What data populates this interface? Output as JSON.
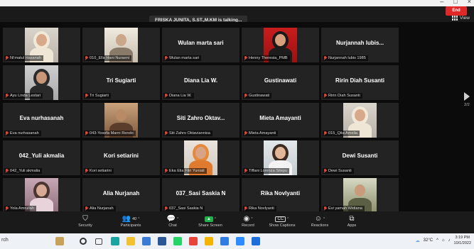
{
  "window": {
    "controls": [
      "–",
      "□",
      "×"
    ]
  },
  "header": {
    "talking": "FRISKA JUNITA, S.ST.,M.KM is talking...",
    "view_label": "View"
  },
  "page_indicator": "2/2",
  "tiles": [
    {
      "label": "Ni'matul Hasanah",
      "big": "",
      "video": "person-hijab-cream"
    },
    {
      "label": "010_Ella Hani Nuraeni",
      "big": "",
      "video": "room-light"
    },
    {
      "label": "Wulan marta sari",
      "big": "Wulan marta sari",
      "video": ""
    },
    {
      "label": "Henny Theresia_PMB",
      "big": "",
      "video": "person-red"
    },
    {
      "label": "Nurjannah lubis 1985",
      "big": "Nurjannah lubis...",
      "video": ""
    },
    {
      "label": "Ayu Linda Lestari",
      "big": "",
      "video": "person-hijab-dark"
    },
    {
      "label": "Tri Sugiarti",
      "big": "Tri Sugiarti",
      "video": ""
    },
    {
      "label": "Diana Lia W.",
      "big": "Diana Lia W.",
      "video": ""
    },
    {
      "label": "Gustinawati",
      "big": "Gustinawati",
      "video": ""
    },
    {
      "label": "Ririn Diah Susanti",
      "big": "Ririn Diah Susanti",
      "video": ""
    },
    {
      "label": "Eva nurhasanah",
      "big": "Eva nurhasanah",
      "video": ""
    },
    {
      "label": "043-Yosefa Marni Rendo",
      "big": "",
      "video": "room-warm"
    },
    {
      "label": "Siti Zahro Oktaviannisa",
      "big": "Siti Zahro Oktav...",
      "video": ""
    },
    {
      "label": "Mieta Amayanti",
      "big": "Mieta Amayanti",
      "video": ""
    },
    {
      "label": "015_Qita Amelia",
      "big": "",
      "video": "person-hijab-cream"
    },
    {
      "label": "042_Yuli akmalia",
      "big": "042_Yuli akmalia",
      "video": ""
    },
    {
      "label": "Kori setiarini",
      "big": "Kori setiarini",
      "video": ""
    },
    {
      "label": "Eka Elia Fitri Yuniati",
      "big": "",
      "video": "person-hijab-orange"
    },
    {
      "label": "Tiffani Lorenza Sitepu",
      "big": "",
      "video": "person-light"
    },
    {
      "label": "Dewi Susanti",
      "big": "Dewi Susanti",
      "video": ""
    },
    {
      "label": "Yola Amrullah",
      "big": "",
      "video": "person-pink"
    },
    {
      "label": "Alia Nurjanah",
      "big": "Alia Nurjanah",
      "video": ""
    },
    {
      "label": "037_Sasi Saskia N",
      "big": "037_Sasi Saskia N",
      "video": ""
    },
    {
      "label": "Rika Novlyanti",
      "big": "Rika Novlyanti",
      "video": ""
    },
    {
      "label": "Evi yamah Widiana",
      "big": "",
      "video": "room-outdoor"
    }
  ],
  "toolbar": {
    "items": [
      {
        "label": "Security",
        "icon": "shield-icon",
        "glyph": "⛉"
      },
      {
        "label": "Participants",
        "icon": "participants-icon",
        "glyph": "👥",
        "count": "40"
      },
      {
        "label": "Chat",
        "icon": "chat-icon",
        "glyph": "💬"
      },
      {
        "label": "Share Screen",
        "icon": "share-screen-icon",
        "glyph": "▲"
      },
      {
        "label": "Record",
        "icon": "record-icon",
        "glyph": "◉"
      },
      {
        "label": "Show Captions",
        "icon": "captions-icon",
        "glyph": "CC"
      },
      {
        "label": "Reactions",
        "icon": "reactions-icon",
        "glyph": "☺"
      },
      {
        "label": "Apps",
        "icon": "apps-icon",
        "glyph": "⧉"
      }
    ],
    "end_label": "End",
    "share_color": "#22b14c",
    "end_color": "#e02828"
  },
  "taskbar": {
    "search_text": "rch",
    "temperature": "32°C",
    "time": "3:19 PM",
    "date": "10/1/2022",
    "apps": [
      {
        "icon": "start-figure-icon",
        "color": "#c8a25a"
      },
      {
        "icon": "search-circle-icon",
        "color": "#333333"
      },
      {
        "icon": "task-view-icon",
        "color": "#444444"
      },
      {
        "icon": "edge-icon",
        "color": "#1aa3a0"
      },
      {
        "icon": "file-explorer-icon",
        "color": "#f2c231"
      },
      {
        "icon": "store-icon",
        "color": "#3a7bd5"
      },
      {
        "icon": "word-icon",
        "color": "#2b5797"
      },
      {
        "icon": "whatsapp-icon",
        "color": "#25d366"
      },
      {
        "icon": "chrome-icon",
        "color": "#e8443a"
      },
      {
        "icon": "chrome-alt-icon",
        "color": "#f4b400"
      },
      {
        "icon": "photos-icon",
        "color": "#2f7de1"
      },
      {
        "icon": "zoom-icon",
        "color": "#2d8cff"
      },
      {
        "icon": "mail-icon",
        "color": "#1e6fd9"
      }
    ]
  }
}
